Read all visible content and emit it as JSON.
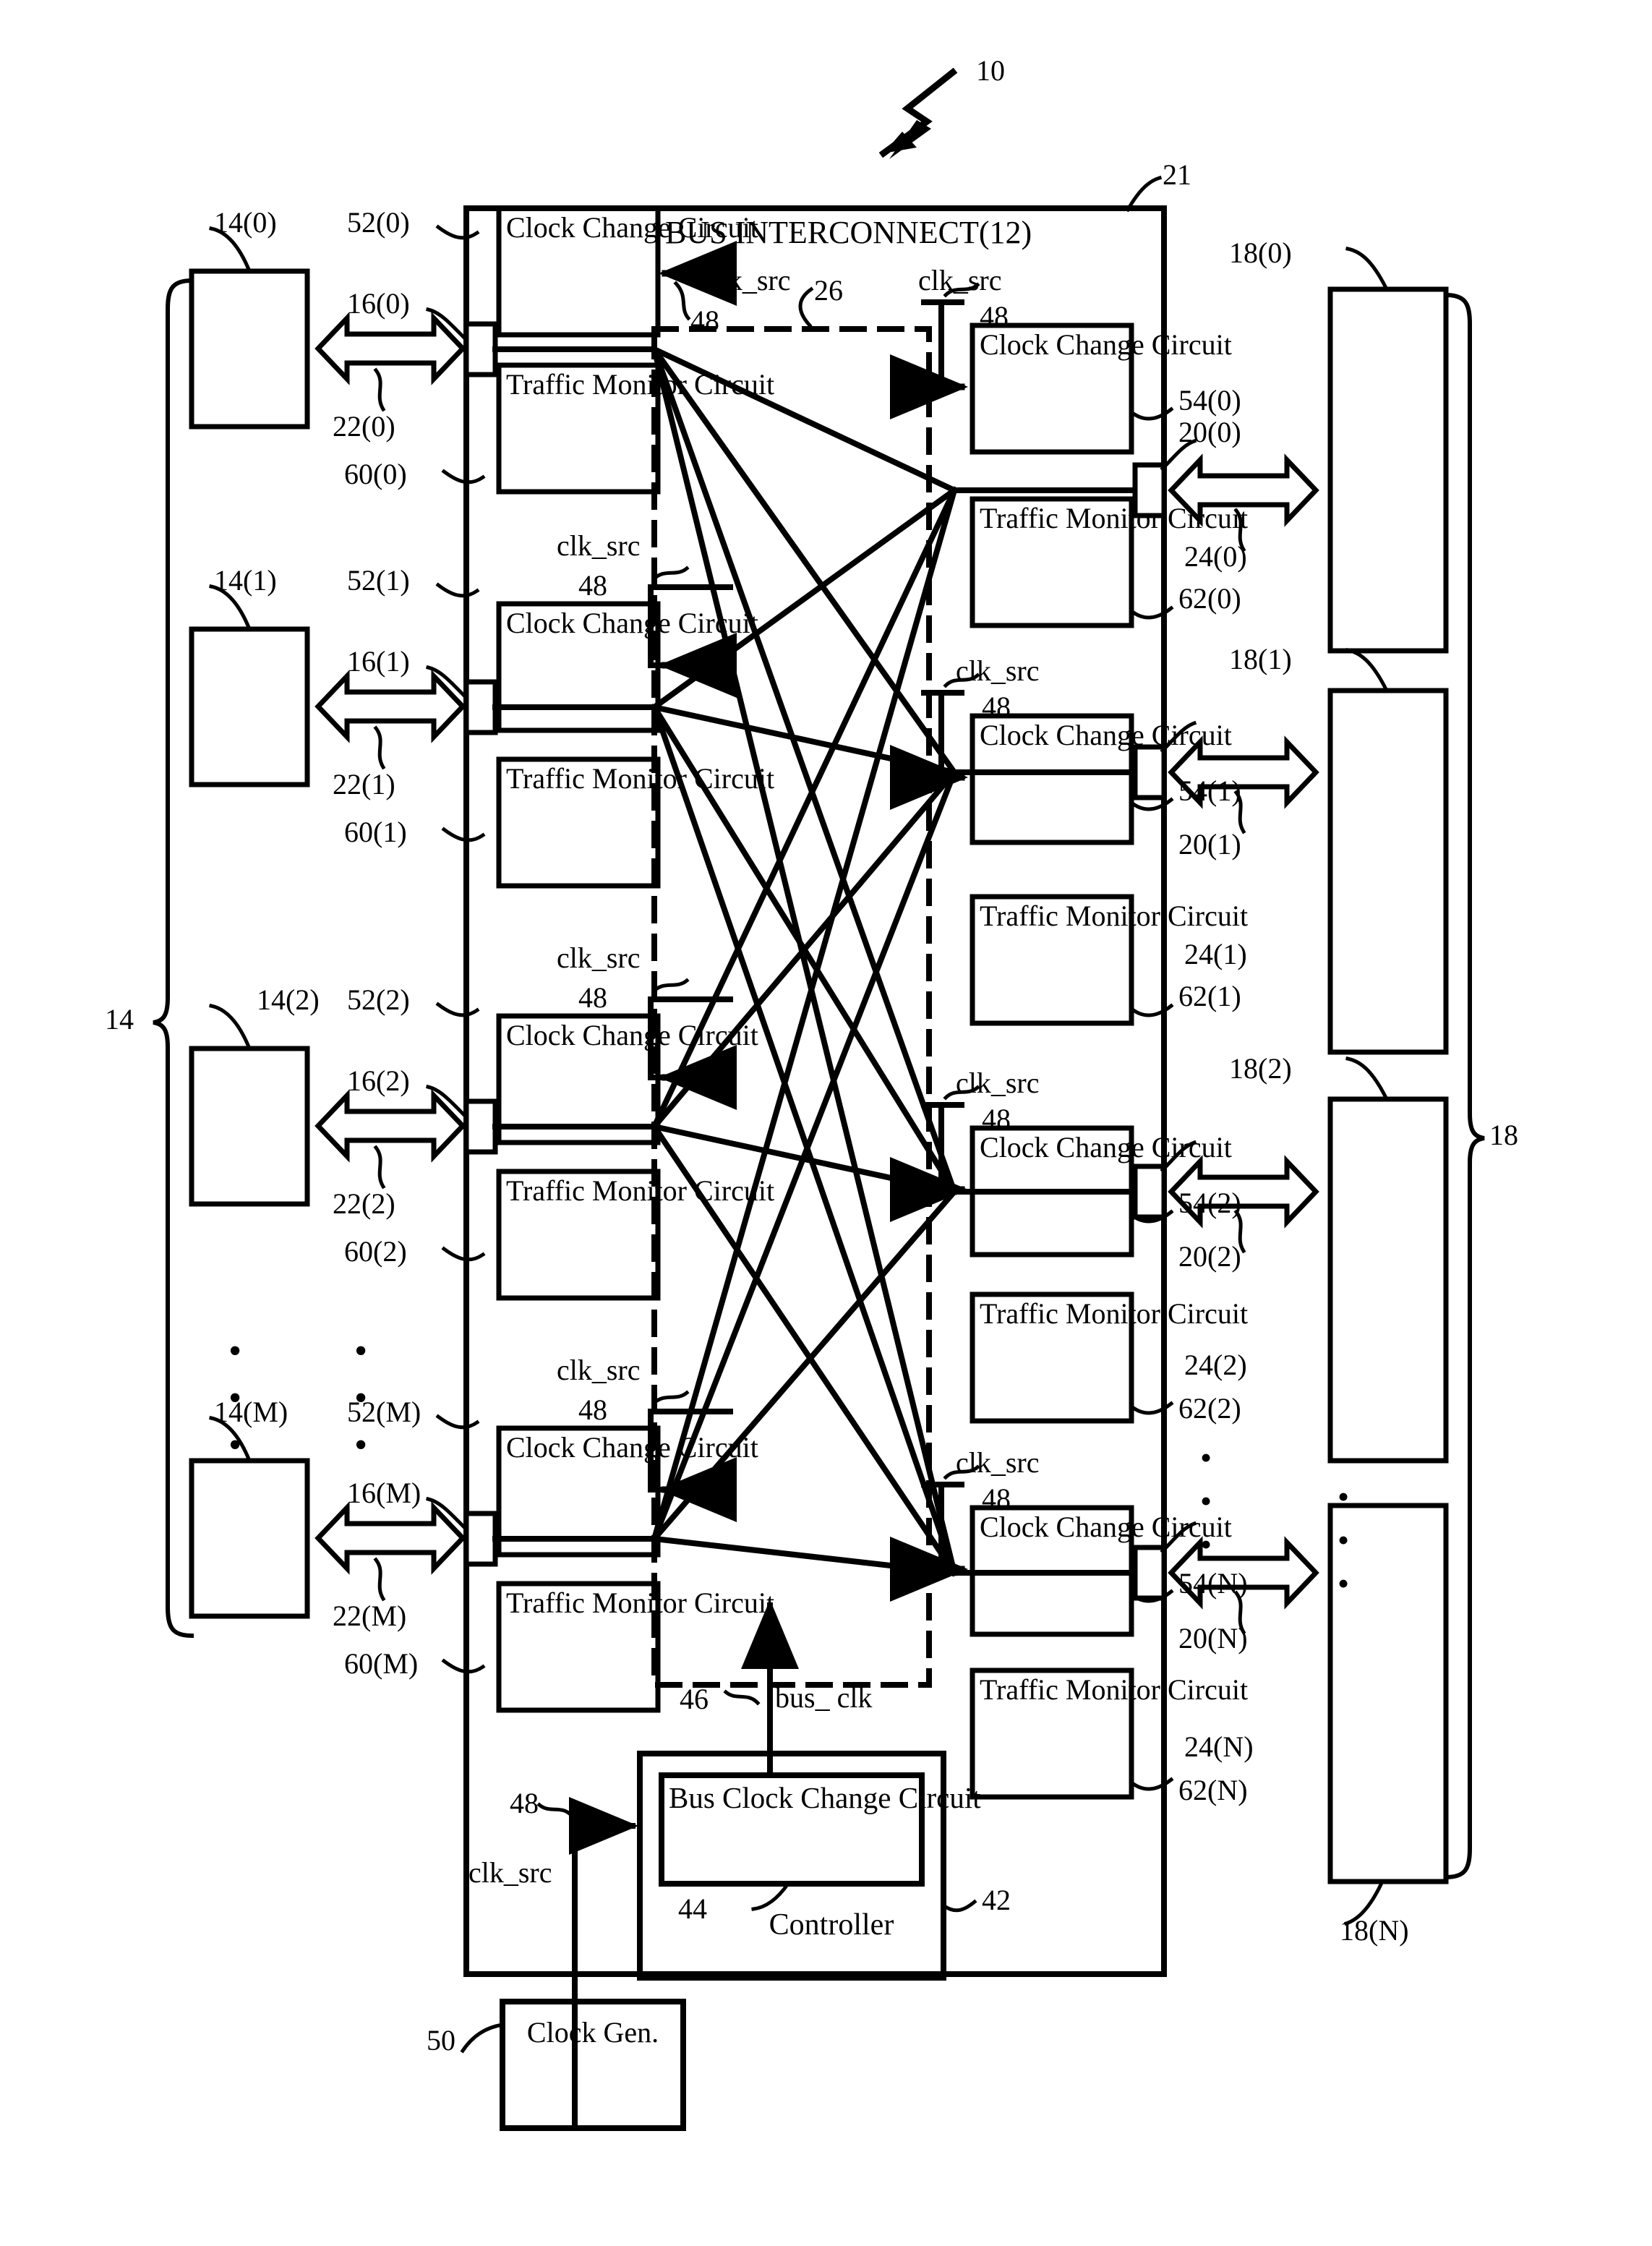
{
  "figure": {
    "figure_ref": "10",
    "interconnect_title": "BUS INTERCONNECT(12)",
    "interconnect_ref": "21",
    "crossbar_ref": "26",
    "controller_label": "Controller",
    "controller_ref": "42",
    "bus_clock_change_label": "Bus Clock Change Circuit",
    "bus_clock_change_ref": "44",
    "bus_clk_signal": "bus_ clk",
    "bus_clk_ref": "46",
    "clk_src_signal": "clk_src",
    "clk_src_ref": "48",
    "clock_gen_label": "Clock Gen.",
    "clock_gen_ref": "50",
    "clock_change_label": "Clock Change Circuit",
    "traffic_monitor_label": "Traffic Monitor Circuit",
    "masters_brace_ref": "14",
    "slaves_brace_ref": "18",
    "dots": "•"
  },
  "masters": [
    {
      "device_ref": "14(0)",
      "clk_port_ref": "52(0)",
      "port_ref": "16(0)",
      "bus_ref": "22(0)",
      "monitor_ref": "60(0)"
    },
    {
      "device_ref": "14(1)",
      "clk_port_ref": "52(1)",
      "port_ref": "16(1)",
      "bus_ref": "22(1)",
      "monitor_ref": "60(1)"
    },
    {
      "device_ref": "14(2)",
      "clk_port_ref": "52(2)",
      "port_ref": "16(2)",
      "bus_ref": "22(2)",
      "monitor_ref": "60(2)"
    },
    {
      "device_ref": "14(M)",
      "clk_port_ref": "52(M)",
      "port_ref": "16(M)",
      "bus_ref": "22(M)",
      "monitor_ref": "60(M)"
    }
  ],
  "slaves": [
    {
      "device_ref": "18(0)",
      "clk_port_ref": "54(0)",
      "port_ref": "20(0)",
      "bus_ref": "24(0)",
      "monitor_ref": "62(0)"
    },
    {
      "device_ref": "18(1)",
      "clk_port_ref": "54(1)",
      "port_ref": "20(1)",
      "bus_ref": "24(1)",
      "monitor_ref": "62(1)"
    },
    {
      "device_ref": "18(2)",
      "clk_port_ref": "54(2)",
      "port_ref": "20(2)",
      "bus_ref": "24(2)",
      "monitor_ref": "62(2)"
    },
    {
      "device_ref": "18(N)",
      "clk_port_ref": "54(N)",
      "port_ref": "20(N)",
      "bus_ref": "24(N)",
      "monitor_ref": "62(N)"
    }
  ]
}
